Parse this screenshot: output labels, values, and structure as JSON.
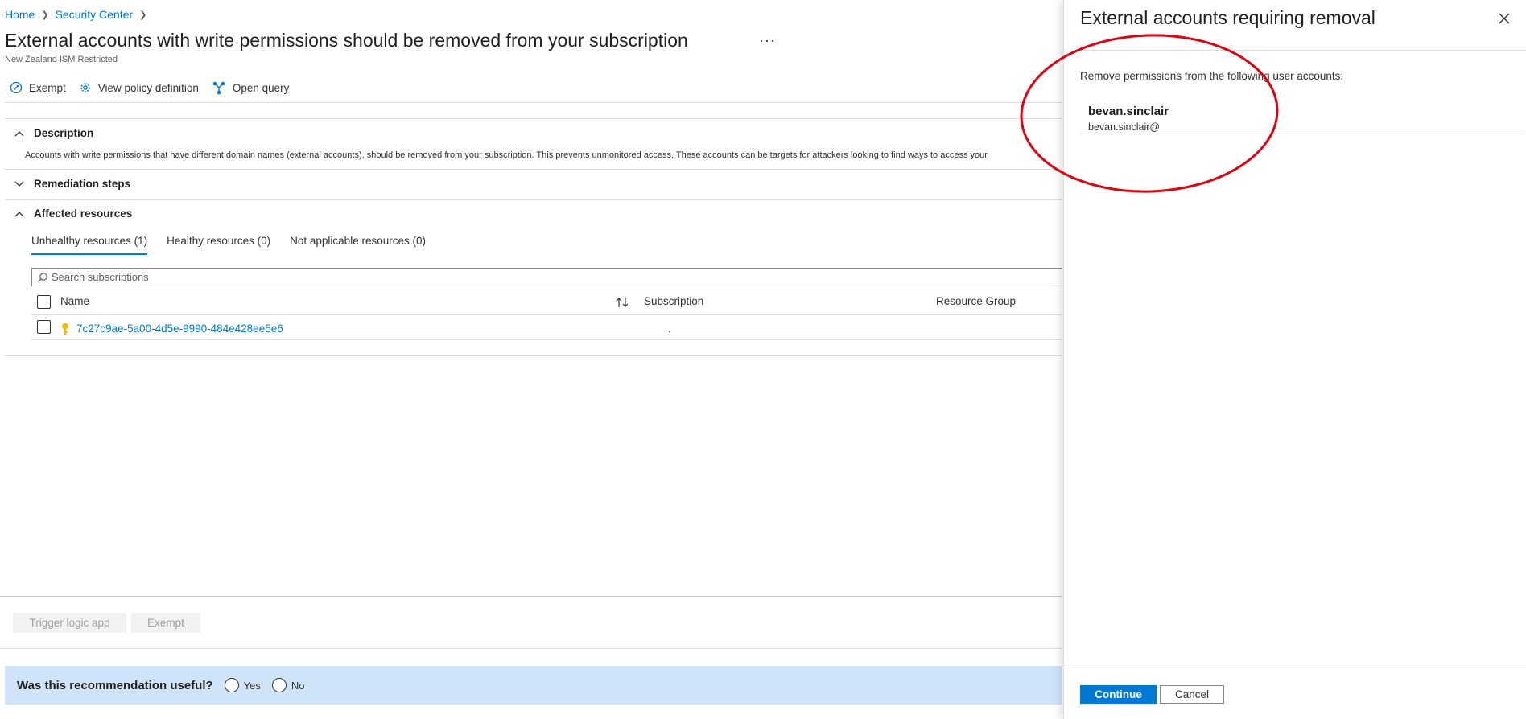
{
  "breadcrumb": {
    "home": "Home",
    "security_center": "Security Center"
  },
  "page": {
    "title": "External accounts with write permissions should be removed from your subscription",
    "more": "···",
    "subtitle": "New Zealand ISM Restricted"
  },
  "toolbar": {
    "exempt": "Exempt",
    "view_policy": "View policy definition",
    "open_query": "Open query"
  },
  "sections": {
    "description": "Description",
    "description_text": "Accounts with write permissions that have different domain names (external accounts), should be removed from your subscription. This prevents unmonitored access. These accounts can be targets for attackers looking to find ways to access your",
    "remediation": "Remediation steps",
    "affected": "Affected resources"
  },
  "tabs": [
    "Unhealthy resources (1)",
    "Healthy resources (0)",
    "Not applicable resources (0)"
  ],
  "search": {
    "placeholder": "Search subscriptions"
  },
  "table": {
    "columns": {
      "name": "Name",
      "subscription": "Subscription",
      "resource_group": "Resource Group"
    },
    "rows": [
      {
        "name": "7c27c9ae-5a00-4d5e-9990-484e428ee5e6",
        "subscription": "."
      }
    ]
  },
  "actions": {
    "trigger": "Trigger logic app",
    "exempt": "Exempt"
  },
  "feedback": {
    "question": "Was this recommendation useful?",
    "yes": "Yes",
    "no": "No"
  },
  "panel": {
    "title": "External accounts requiring removal",
    "instructions": "Remove permissions from the following user accounts:",
    "account_name": "bevan.sinclair",
    "account_email": "bevan.sinclair@",
    "continue": "Continue",
    "cancel": "Cancel"
  },
  "colors": {
    "accent": "#0078d4",
    "annotation": "#e3000f",
    "feedback_bg": "#cfe4f8",
    "key_icon": "#f5b800"
  }
}
